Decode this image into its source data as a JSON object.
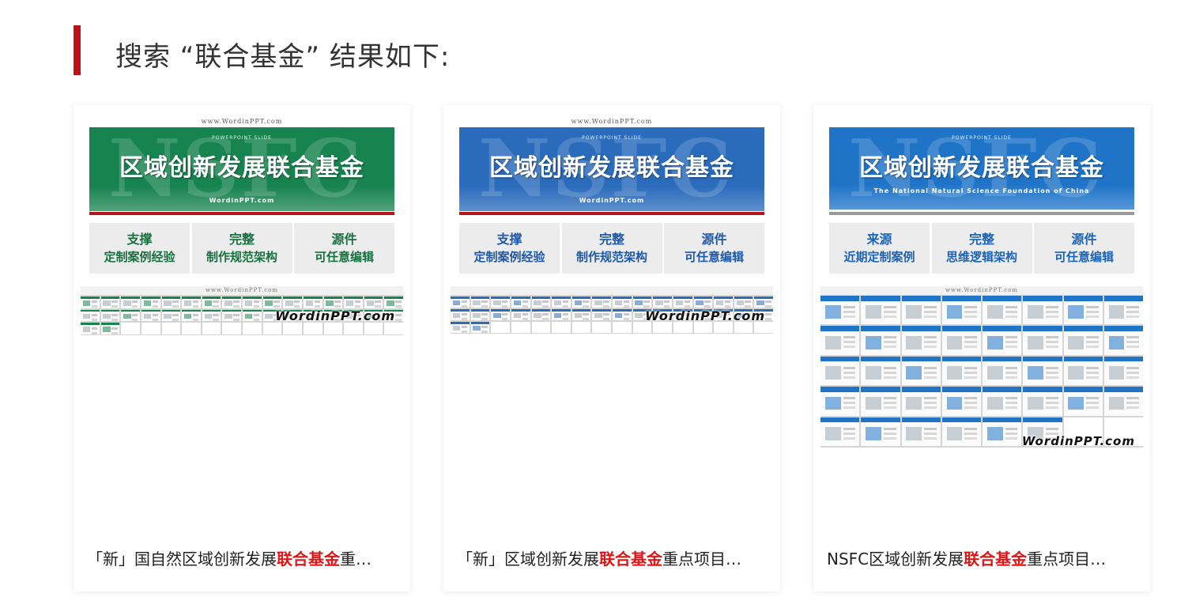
{
  "page": {
    "title": "搜索 “联合基金” 结果如下:",
    "accent_color": "#c0111a",
    "highlight_color": "#e01515"
  },
  "cards": [
    {
      "banner": {
        "site_url": "www.WordinPPT.com",
        "watermark": "NSFC",
        "subtitle": "POWERPOINT SLIDE",
        "main": "区域创新发展联合基金",
        "foot": "WordinPPT.com",
        "color": "#17834f",
        "line_color": "#b8131b"
      },
      "features": [
        {
          "head": "支撑",
          "line": "定制案例经验"
        },
        {
          "head": "完整",
          "line": "制作规范架构"
        },
        {
          "head": "源件",
          "line": "可任意编辑"
        }
      ],
      "feature_color": "#17703f",
      "thumb_url": "www.WordinPPT.com",
      "thumb_watermark": "WordinPPT.com",
      "title": {
        "before": "「新」国自然区域创新发展",
        "keyword": "联合基金",
        "after": "重…"
      }
    },
    {
      "banner": {
        "site_url": "www.WordinPPT.com",
        "watermark": "NSFC",
        "subtitle": "POWERPOINT SLIDE",
        "main": "区域创新发展联合基金",
        "foot": "WordinPPT.com",
        "color": "#2a6bbb",
        "line_color": "#b8131b"
      },
      "features": [
        {
          "head": "支撑",
          "line": "定制案例经验"
        },
        {
          "head": "完整",
          "line": "制作规范架构"
        },
        {
          "head": "源件",
          "line": "可任意编辑"
        }
      ],
      "feature_color": "#1e58a8",
      "thumb_url": "",
      "thumb_watermark": "WordinPPT.com",
      "title": {
        "before": "「新」区域创新发展",
        "keyword": "联合基金",
        "after": "重点项目…"
      }
    },
    {
      "banner": {
        "site_url": "",
        "watermark": "NSFC",
        "subtitle": "POWERPOINT SLIDE",
        "main": "区域创新发展联合基金",
        "foot": "The National Natural Science Foundation of China",
        "color": "#1f74c8",
        "line_color": "#9a9a9a"
      },
      "features": [
        {
          "head": "来源",
          "line": "近期定制案例"
        },
        {
          "head": "完整",
          "line": "思维逻辑架构"
        },
        {
          "head": "源件",
          "line": "可任意编辑"
        }
      ],
      "feature_color": "#1b63b8",
      "thumb_url": "www.WordinPPT.com",
      "thumb_watermark": "WordinPPT.com",
      "title": {
        "before": "NSFC区域创新发展",
        "keyword": "联合基金",
        "after": "重点项目…"
      }
    }
  ]
}
